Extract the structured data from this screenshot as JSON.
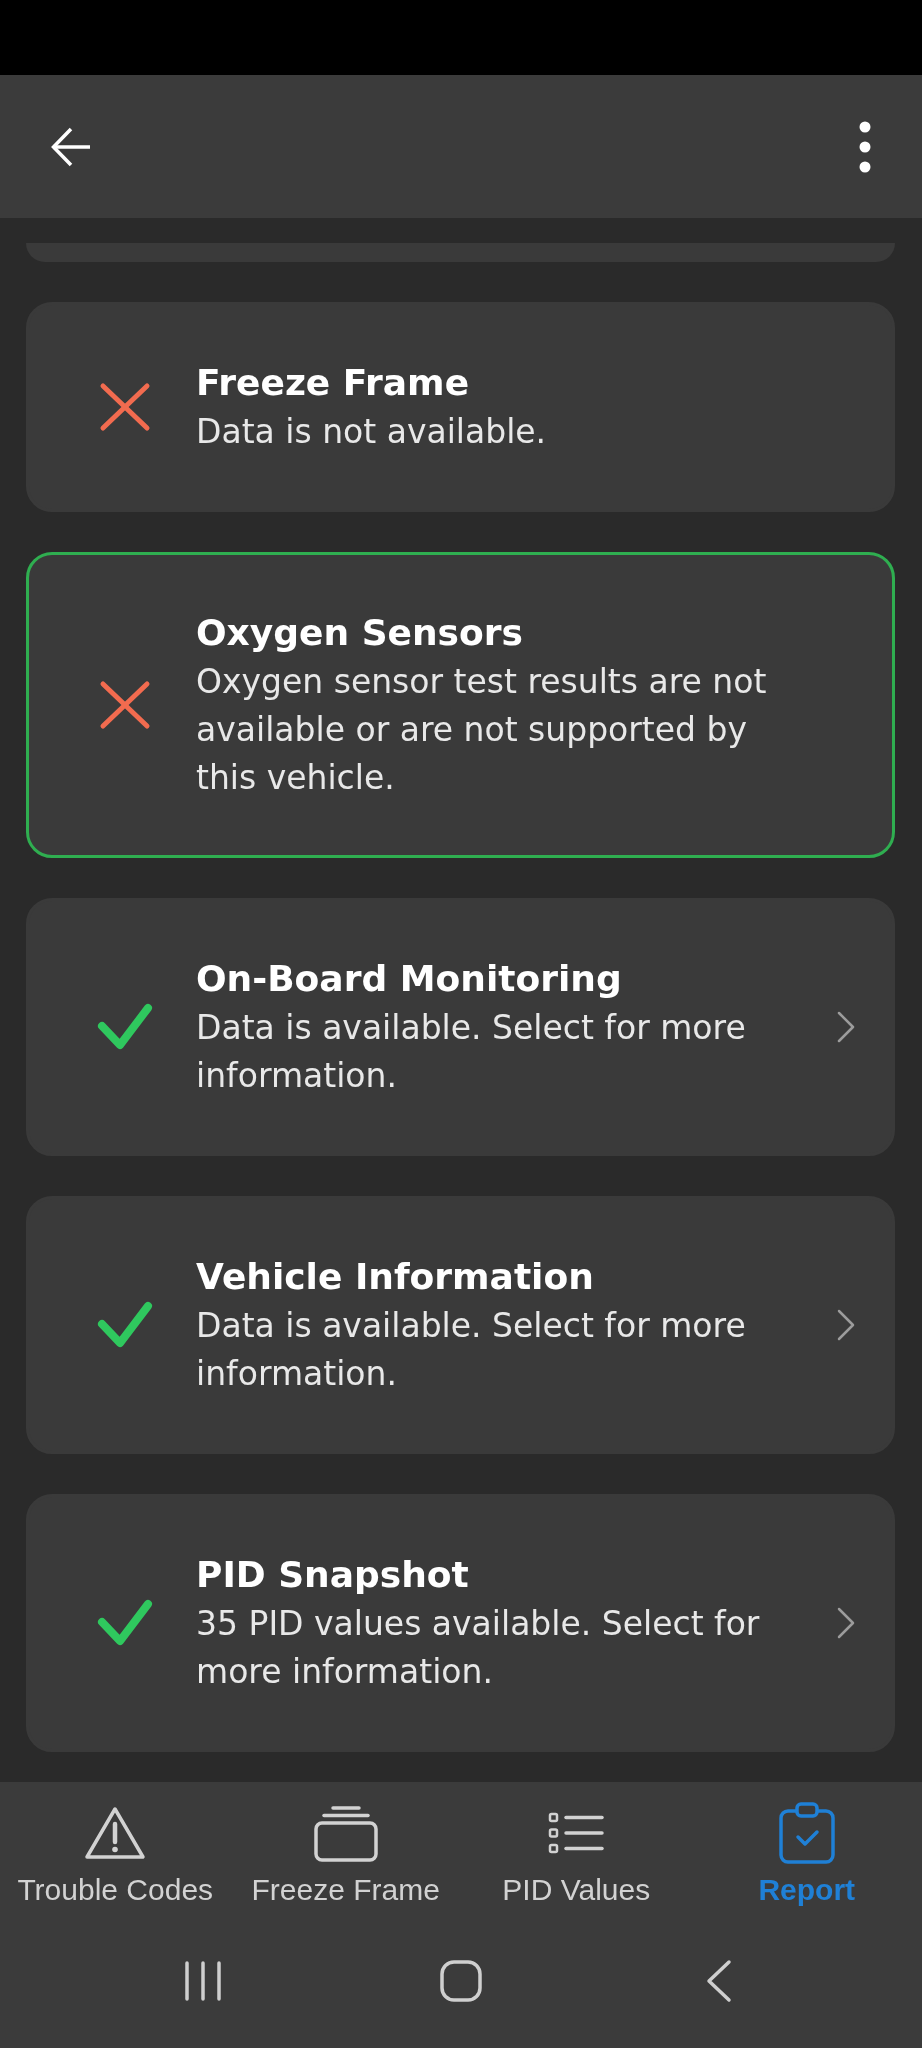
{
  "report_items": [
    {
      "title": "Freeze Frame",
      "description": "Data is not available.",
      "available": false,
      "selected": false
    },
    {
      "title": "Oxygen Sensors",
      "description": "Oxygen sensor test results are not available or are not supported by this vehicle.",
      "available": false,
      "selected": true
    },
    {
      "title": "On-Board Monitoring",
      "description": "Data is available. Select for more information.",
      "available": true,
      "selected": false
    },
    {
      "title": "Vehicle Information",
      "description": "Data is available. Select for more information.",
      "available": true,
      "selected": false
    },
    {
      "title": "PID Snapshot",
      "description": "35 PID values available. Select for more information.",
      "available": true,
      "selected": false
    }
  ],
  "nav_tabs": [
    {
      "label": "Trouble Codes",
      "selected": false
    },
    {
      "label": "Freeze Frame",
      "selected": false
    },
    {
      "label": "PID Values",
      "selected": false
    },
    {
      "label": "Report",
      "selected": true
    }
  ]
}
